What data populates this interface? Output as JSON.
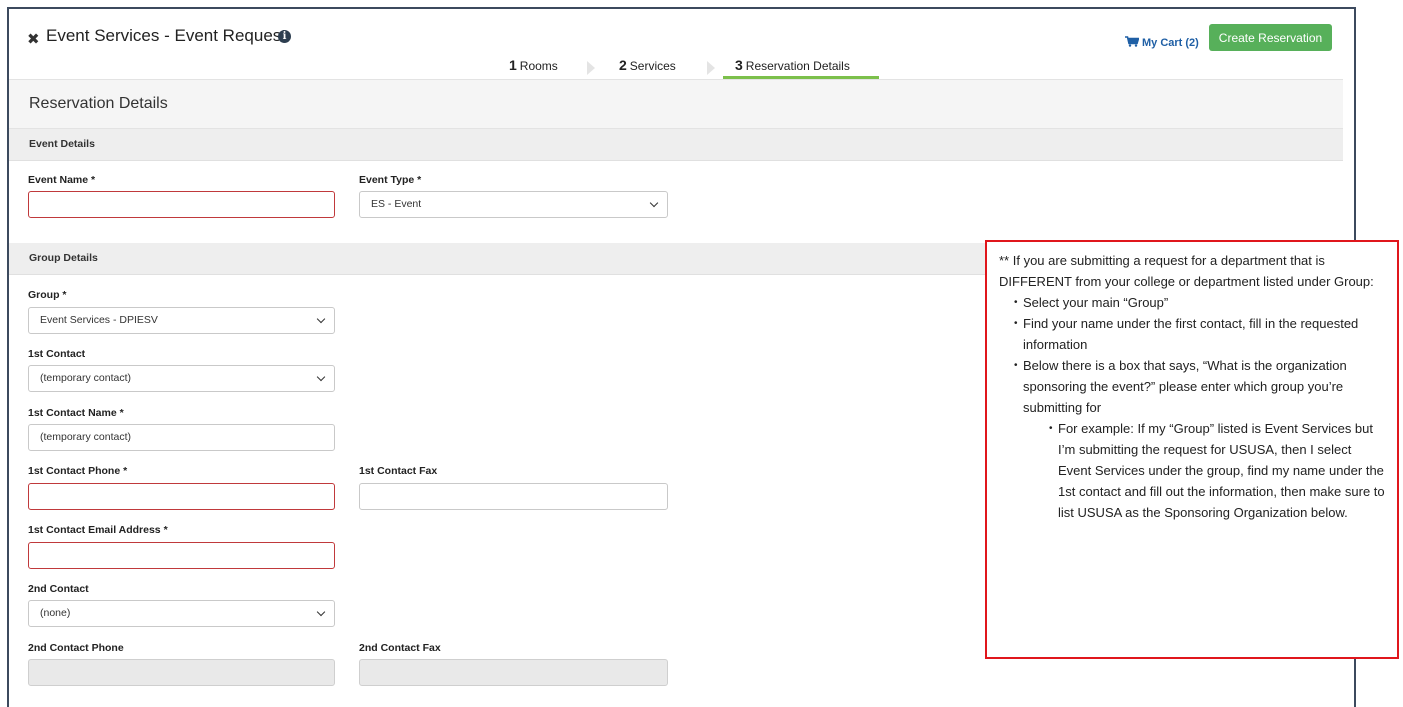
{
  "header": {
    "title": "Event Services - Event Request",
    "cart_label": "My Cart (2)",
    "create_label": "Create Reservation"
  },
  "steps": [
    {
      "num": "1",
      "label": "Rooms"
    },
    {
      "num": "2",
      "label": "Services"
    },
    {
      "num": "3",
      "label": "Reservation Details"
    }
  ],
  "active_step": "3",
  "page_section": "Reservation Details",
  "event_details": {
    "header": "Event Details",
    "event_name_label": "Event Name *",
    "event_name_value": "",
    "event_type_label": "Event Type *",
    "event_type_value": "ES - Event"
  },
  "group_details": {
    "header": "Group Details",
    "group_label": "Group *",
    "group_value": "Event Services - DPIESV",
    "contact1_label": "1st Contact",
    "contact1_value": "(temporary contact)",
    "contact1_name_label": "1st Contact Name *",
    "contact1_name_value": "(temporary contact)",
    "contact1_phone_label": "1st Contact Phone *",
    "contact1_phone_value": "",
    "contact1_fax_label": "1st Contact Fax",
    "contact1_fax_value": "",
    "contact1_email_label": "1st Contact Email Address *",
    "contact1_email_value": "",
    "contact2_label": "2nd Contact",
    "contact2_value": "(none)",
    "contact2_phone_label": "2nd Contact Phone",
    "contact2_fax_label": "2nd Contact Fax"
  },
  "callout": {
    "intro": "** If you are submitting a request for a department that is DIFFERENT from your college or department listed under Group:",
    "bullets": [
      "Select your main “Group”",
      "Find your name under the first contact, fill in the requested information",
      "Below there is a box that says, “What is the organization sponsoring the event?” please enter which group you’re submitting for"
    ],
    "sub_bullet": "For example: If my “Group” listed is Event Services but I’m submitting the request for USUSA, then I select Event Services under the group, find my name under the 1st contact and fill out the information, then make sure to list USUSA as the Sponsoring Organization below."
  },
  "colors": {
    "accent_green": "#57b05a",
    "active_step_underline": "#7cc04b",
    "error_border": "#c0393b",
    "callout_border": "#e0161c",
    "cart_blue": "#1f5fa5"
  },
  "icons": [
    "close-icon",
    "info-icon",
    "cart-icon",
    "chevron-down-icon",
    "step-arrow-icon"
  ]
}
